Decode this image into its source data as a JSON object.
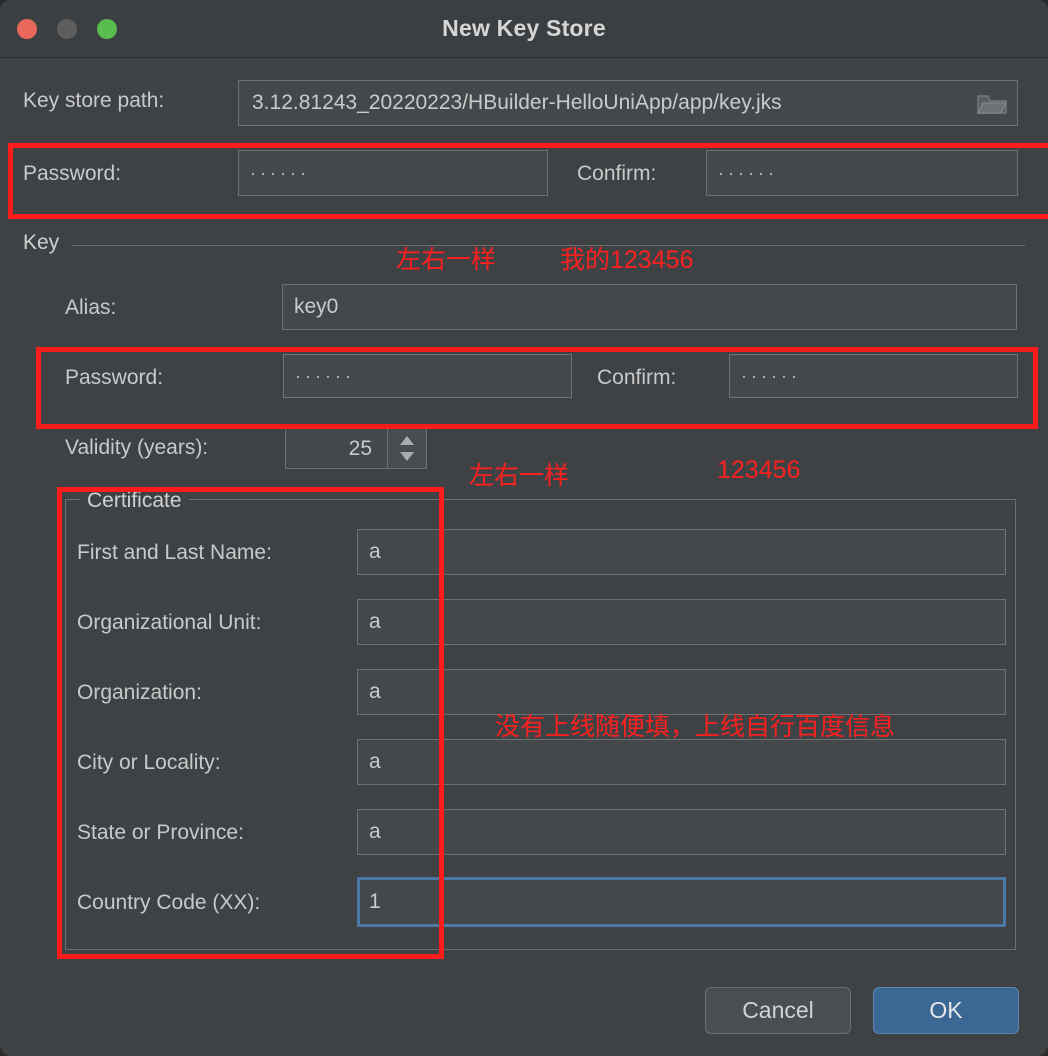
{
  "window": {
    "title": "New Key Store",
    "traffic_lights": {
      "close_color": "#e8685c",
      "minimize_color": "#5e5e5e",
      "zoom_color": "#59bd4d"
    }
  },
  "key_store": {
    "path_label": "Key store path:",
    "path_value": "3.12.81243_20220223/HBuilder-HelloUniApp/app/key.jks",
    "browse_icon": "folder-icon",
    "password_label": "Password:",
    "password_value": "······",
    "confirm_label": "Confirm:",
    "confirm_value": "······"
  },
  "key_section": {
    "group_label": "Key",
    "alias_label": "Alias:",
    "alias_value": "key0",
    "password_label": "Password:",
    "password_value": "······",
    "confirm_label": "Confirm:",
    "confirm_value": "······",
    "validity_label": "Validity (years):",
    "validity_value": "25"
  },
  "certificate": {
    "group_label": "Certificate",
    "fields": [
      {
        "label": "First and Last Name:",
        "value": "a"
      },
      {
        "label": "Organizational Unit:",
        "value": "a"
      },
      {
        "label": "Organization:",
        "value": "a"
      },
      {
        "label": "City or Locality:",
        "value": "a"
      },
      {
        "label": "State or Province:",
        "value": "a"
      },
      {
        "label": "Country Code (XX):",
        "value": "1"
      }
    ]
  },
  "annotations": {
    "color": "#fb2020",
    "note_same_left_right_1": "左右一样",
    "note_my_123456": "我的123456",
    "note_same_left_right_2": "左右一样",
    "note_123456": "123456",
    "note_fill_anything": "没有上线随便填，上线自行百度信息"
  },
  "buttons": {
    "cancel": "Cancel",
    "ok": "OK",
    "ok_color": "#3b6795"
  }
}
